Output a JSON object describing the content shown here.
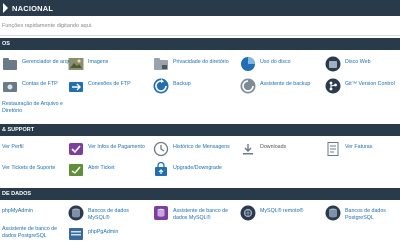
{
  "brand": {
    "name": "NACIONAL"
  },
  "search": {
    "placeholder": "Funções rapidamente digitando aqui."
  },
  "sections": [
    {
      "title": "OS",
      "items": [
        {
          "label": "Gerenciador de arquivos",
          "icon": "file-manager-icon"
        },
        {
          "label": "Imagens",
          "icon": "images-icon"
        },
        {
          "label": "Privacidade do diretório",
          "icon": "directory-privacy-icon"
        },
        {
          "label": "Uso do disco",
          "icon": "disk-usage-icon"
        },
        {
          "label": "Disco Web",
          "icon": "web-disk-icon"
        },
        {
          "label": "Contas de FTP",
          "icon": "ftp-accounts-icon"
        },
        {
          "label": "Conexões de FTP",
          "icon": "ftp-connections-icon"
        },
        {
          "label": "Backup",
          "icon": "backup-icon"
        },
        {
          "label": "Assistente de backup",
          "icon": "backup-wizard-icon"
        },
        {
          "label": "Git™ Version Control",
          "icon": "git-icon"
        },
        {
          "label": "Restauração de Arquivo e Diretório",
          "icon": "restore-icon"
        }
      ]
    },
    {
      "title": "& SUPPORT",
      "items": [
        {
          "label": "Ver Perfil",
          "icon": "profile-icon"
        },
        {
          "label": "Ver Infos de Pagamento",
          "icon": "payment-icon"
        },
        {
          "label": "Histórico de Mensagens",
          "icon": "message-history-icon"
        },
        {
          "label": "Downloads",
          "icon": "downloads-icon"
        },
        {
          "label": "Ver Faturas",
          "icon": "invoices-icon"
        },
        {
          "label": "Ver Tickets de Suporte",
          "icon": "support-tickets-icon"
        },
        {
          "label": "Abrir Ticket",
          "icon": "open-ticket-icon"
        },
        {
          "label": "Upgrade/Downgrade",
          "icon": "upgrade-icon"
        }
      ]
    },
    {
      "title": "DE DADOS",
      "items": [
        {
          "label": "phpMyAdmin",
          "icon": "phpmyadmin-icon"
        },
        {
          "label": "Bancos de dados MySQL®",
          "icon": "mysql-databases-icon"
        },
        {
          "label": "Assistente de banco de dados MySQL®",
          "icon": "mysql-wizard-icon"
        },
        {
          "label": "MySQL® remoto®",
          "icon": "remote-mysql-icon"
        },
        {
          "label": "Bancos de dados PostgreSQL",
          "icon": "postgresql-databases-icon"
        },
        {
          "label": "Assistente de banco de dados PostgreSQL",
          "icon": "postgresql-wizard-icon"
        },
        {
          "label": "phpPgAdmin",
          "icon": "phppgadmin-icon"
        }
      ]
    }
  ],
  "colors": {
    "header": "#293a4a",
    "link": "#1a6fb5",
    "divider": "#d9dde1"
  }
}
